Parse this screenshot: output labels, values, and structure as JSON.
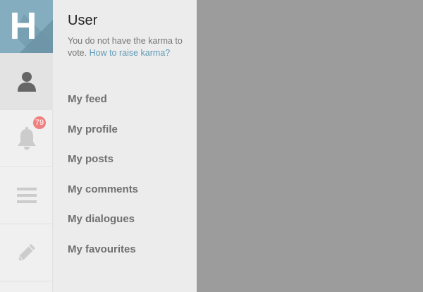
{
  "app": {
    "logo_letter": "H"
  },
  "rail": {
    "buttons": [
      {
        "name": "profile",
        "icon": "user-icon",
        "active": true
      },
      {
        "name": "notifications",
        "icon": "bell-icon",
        "badge": "79"
      },
      {
        "name": "menu",
        "icon": "hamburger-menu-icon"
      },
      {
        "name": "write",
        "icon": "pencil-icon"
      }
    ]
  },
  "panel": {
    "title": "User",
    "karma_note": "You do not have the karma to vote.",
    "karma_link": "How to raise karma?",
    "menu": [
      "My feed",
      "My profile",
      "My posts",
      "My comments",
      "My dialogues",
      "My favourites"
    ]
  },
  "colors": {
    "logo_bg": "#84aebf",
    "rail_bg": "#f0f0f0",
    "panel_bg": "#ececec",
    "overlay_bg": "#9c9c9c",
    "link": "#5e9bb8",
    "badge_bg": "#f08080"
  }
}
